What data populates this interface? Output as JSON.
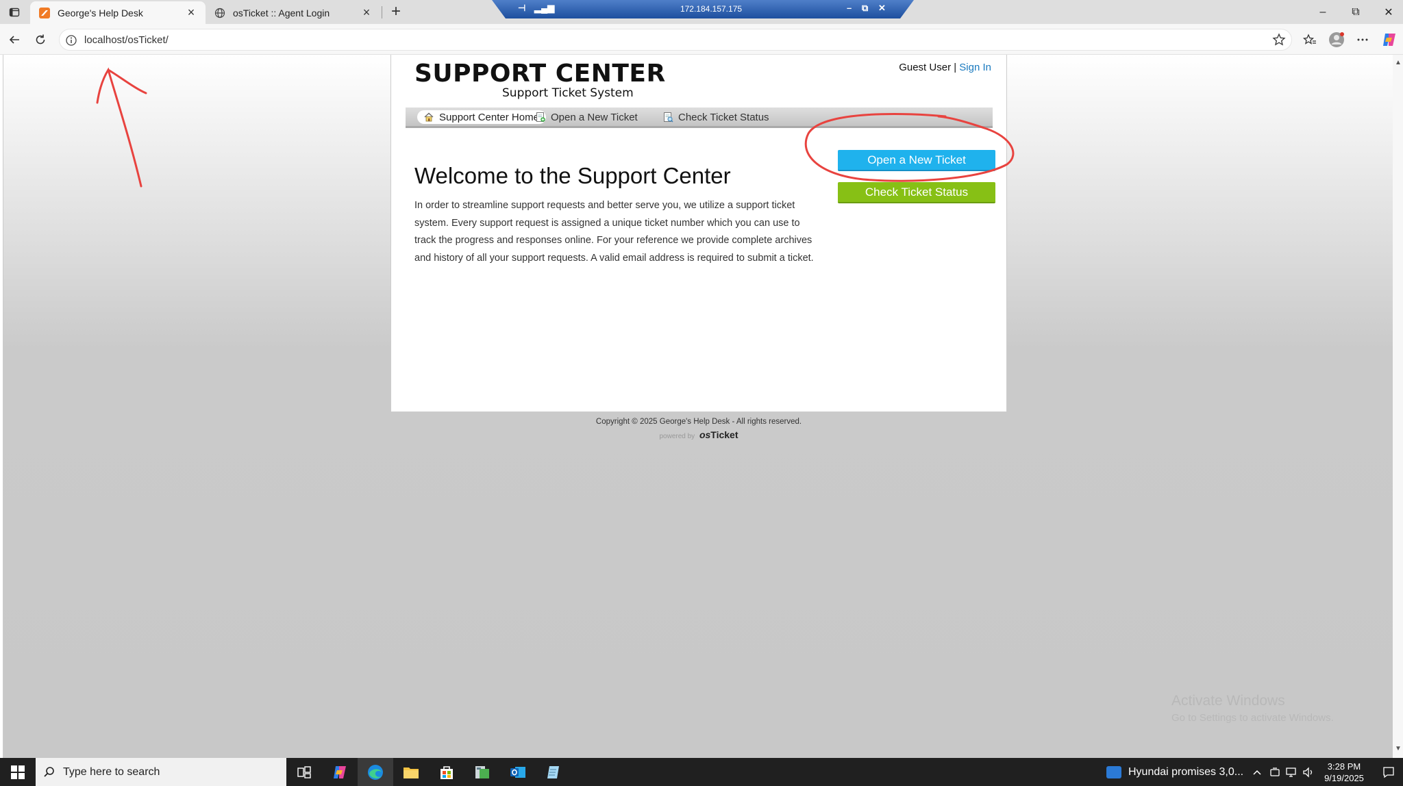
{
  "browser": {
    "tabs": [
      {
        "title": "George's Help Desk",
        "icon": "osticket-favicon",
        "active": true
      },
      {
        "title": "osTicket :: Agent Login",
        "icon": "globe-icon",
        "active": false
      }
    ],
    "url": "localhost/osTicket/",
    "rdp_ip": "172.184.157.175"
  },
  "page": {
    "logo_main": "SUPPORT CENTER",
    "logo_sub": "Support Ticket System",
    "guest_user": "Guest User",
    "separator": " | ",
    "sign_in": "Sign In",
    "nav": [
      {
        "label": "Support Center Home",
        "icon": "home-icon",
        "active": true
      },
      {
        "label": "Open a New Ticket",
        "icon": "new-ticket-icon",
        "active": false
      },
      {
        "label": "Check Ticket Status",
        "icon": "ticket-status-icon",
        "active": false
      }
    ],
    "welcome_title": "Welcome to the Support Center",
    "intro_text": "In order to streamline support requests and better serve you, we utilize a support ticket system. Every support request is assigned a unique ticket number which you can use to track the progress and responses online. For your reference we provide complete archives and history of all your support requests. A valid email address is required to submit a ticket.",
    "open_ticket_button": "Open a New Ticket",
    "check_status_button": "Check Ticket Status",
    "copyright": "Copyright © 2025 George's Help Desk - All rights reserved.",
    "powered_by": "powered by",
    "brand_os": "os",
    "brand_ticket": "Ticket"
  },
  "watermark": {
    "line1": "Activate Windows",
    "line2": "Go to Settings to activate Windows."
  },
  "taskbar": {
    "search_placeholder": "Type here to search",
    "news": "Hyundai promises 3,0...",
    "time": "3:28 PM",
    "date": "9/19/2025"
  },
  "colors": {
    "open_button": "#1fb2ed",
    "check_button": "#87c015",
    "link": "#1a7abf",
    "annotation": "#e8433f"
  }
}
